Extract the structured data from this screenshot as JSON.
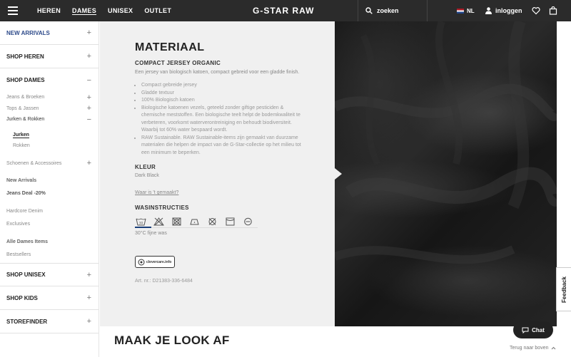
{
  "header": {
    "nav": [
      "HEREN",
      "DAMES",
      "UNISEX",
      "OUTLET"
    ],
    "active_nav": "DAMES",
    "logo": "G-STAR RAW",
    "search_placeholder": "zoeken",
    "lang": "NL",
    "login": "inloggen"
  },
  "sidebar": {
    "new_arrivals": "NEW ARRIVALS",
    "shop_heren": "SHOP HEREN",
    "shop_dames": "SHOP DAMES",
    "sub": {
      "jeans": "Jeans & Broeken",
      "tops": "Tops & Jassen",
      "jurken_rokken": "Jurken & Rokken",
      "jurken": "Jurken",
      "rokken": "Rokken",
      "schoenen": "Schoenen & Accessoires",
      "new_arrivals": "New Arrivals",
      "jeans_deal": "Jeans Deal -20%",
      "hardcore": "Hardcore Denim",
      "exclusives": "Exclusives",
      "alle_dames": "Alle Dames Items",
      "bestsellers": "Bestsellers"
    },
    "shop_unisex": "SHOP UNISEX",
    "shop_kids": "SHOP KIDS",
    "storefinder": "STOREFINDER"
  },
  "product": {
    "title": "MATERIAAL",
    "material_name": "COMPACT JERSEY ORGANIC",
    "material_desc": "Een jersey van biologisch katoen, compact gebreid voor een gladde finish.",
    "bullets": [
      "Compact gebreide jersey",
      "Gladde textuur",
      "100% Biologisch katoen",
      "Biologische katoenen vezels, geteeld zonder giftige pesticiden & chemische meststoffen. Een biologische teelt helpt de bodemkwaliteit te verbeteren, voorkomt waterverontreiniging en behoudt biodiversiteit. Waarbij tot 60% water bespaard wordt.",
      "RAW Sustainable. RAW Sustainable-items zijn gemaakt van duurzame materialen die helpen de impact van de G-Star-collectie op het milieu tot een minimum te beperken."
    ],
    "kleur_title": "KLEUR",
    "kleur": "Dark Black",
    "made_link": "Waar is 't gemaakt?",
    "wash_title": "WASINSTRUCTIES",
    "wash_text": "30°C fijne was",
    "clevercare": "clevercare.info",
    "art_nr": "Art. nr.: D21383-336-6484"
  },
  "footer": {
    "look_title": "MAAK JE LOOK AF",
    "back_to_top": "Terug naar boven",
    "chat": "Chat",
    "feedback": "Feedback"
  }
}
